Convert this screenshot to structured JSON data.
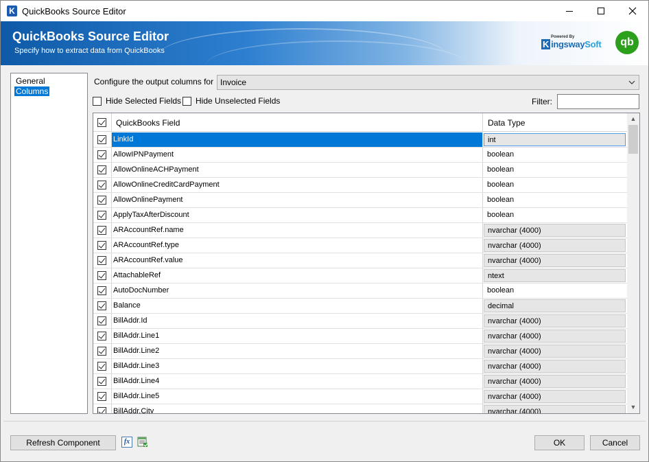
{
  "window": {
    "title": "QuickBooks Source Editor"
  },
  "banner": {
    "title": "QuickBooks Source Editor",
    "subtitle": "Specify how to extract data from QuickBooks",
    "powered_by": "Powered By",
    "brand_k": "K",
    "brand_rest": "ingsway",
    "brand_soft": "Soft",
    "qb_logo": "qb"
  },
  "nav": {
    "items": [
      {
        "label": "General",
        "selected": false
      },
      {
        "label": "Columns",
        "selected": true
      }
    ]
  },
  "config": {
    "label": "Configure the output columns for",
    "selected_value": "Invoice"
  },
  "options": {
    "hide_selected": "Hide Selected Fields",
    "hide_unselected": "Hide Unselected Fields",
    "filter_label": "Filter:",
    "filter_value": ""
  },
  "grid": {
    "header_field": "QuickBooks Field",
    "header_type": "Data Type",
    "rows": [
      {
        "field": "LinkId",
        "type": "int",
        "editable": true,
        "selected": true
      },
      {
        "field": "AllowIPNPayment",
        "type": "boolean",
        "editable": false
      },
      {
        "field": "AllowOnlineACHPayment",
        "type": "boolean",
        "editable": false
      },
      {
        "field": "AllowOnlineCreditCardPayment",
        "type": "boolean",
        "editable": false
      },
      {
        "field": "AllowOnlinePayment",
        "type": "boolean",
        "editable": false
      },
      {
        "field": "ApplyTaxAfterDiscount",
        "type": "boolean",
        "editable": false
      },
      {
        "field": "ARAccountRef.name",
        "type": "nvarchar (4000)",
        "editable": true
      },
      {
        "field": "ARAccountRef.type",
        "type": "nvarchar (4000)",
        "editable": true
      },
      {
        "field": "ARAccountRef.value",
        "type": "nvarchar (4000)",
        "editable": true
      },
      {
        "field": "AttachableRef",
        "type": "ntext",
        "editable": true
      },
      {
        "field": "AutoDocNumber",
        "type": "boolean",
        "editable": false
      },
      {
        "field": "Balance",
        "type": "decimal",
        "editable": true
      },
      {
        "field": "BillAddr.Id",
        "type": "nvarchar (4000)",
        "editable": true
      },
      {
        "field": "BillAddr.Line1",
        "type": "nvarchar (4000)",
        "editable": true
      },
      {
        "field": "BillAddr.Line2",
        "type": "nvarchar (4000)",
        "editable": true
      },
      {
        "field": "BillAddr.Line3",
        "type": "nvarchar (4000)",
        "editable": true
      },
      {
        "field": "BillAddr.Line4",
        "type": "nvarchar (4000)",
        "editable": true
      },
      {
        "field": "BillAddr.Line5",
        "type": "nvarchar (4000)",
        "editable": true
      },
      {
        "field": "BillAddr.City",
        "type": "nvarchar (4000)",
        "editable": true
      }
    ]
  },
  "footer": {
    "refresh_label": "Refresh Component",
    "fx_label": "fx",
    "ok_label": "OK",
    "cancel_label": "Cancel"
  }
}
